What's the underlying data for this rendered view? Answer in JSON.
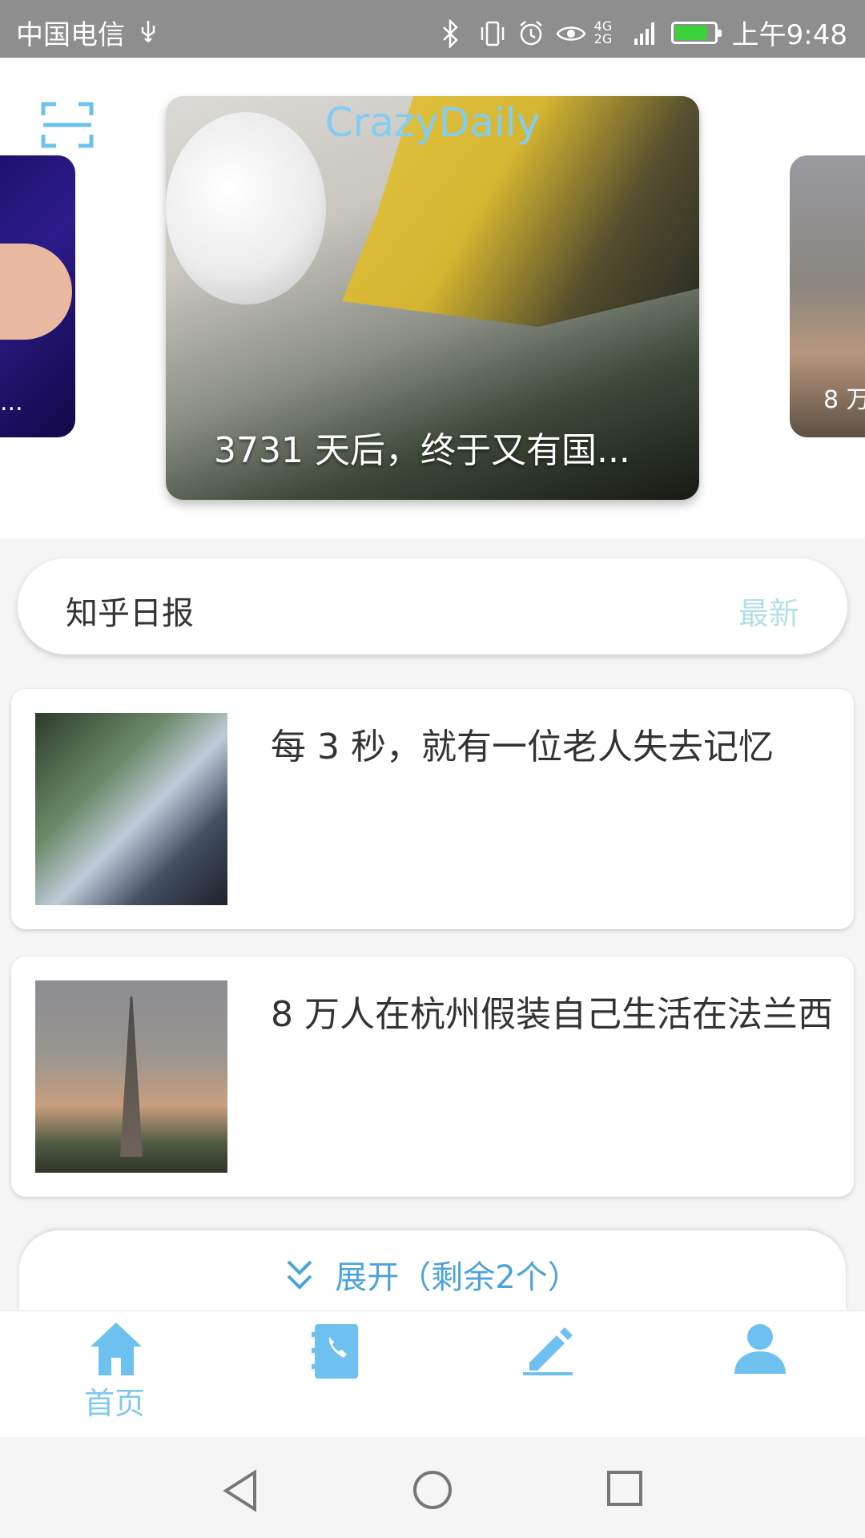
{
  "status_bar": {
    "carrier": "中国电信",
    "time": "上午9:48",
    "signal_text": "4G 2G",
    "icons": [
      "usb-icon",
      "bluetooth-icon",
      "vibrate-icon",
      "alarm-icon",
      "eye-icon",
      "signal-icon",
      "battery-icon"
    ]
  },
  "header": {
    "app_title": "CrazyDaily",
    "scan_icon": "scan-icon"
  },
  "carousel": {
    "main_caption": "3731 天后，终于又有国...",
    "left_caption": "...",
    "right_caption": "8 万"
  },
  "section": {
    "title": "知乎日报",
    "link": "最新"
  },
  "articles": [
    {
      "title": "每 3 秒，就有一位老人失去记忆"
    },
    {
      "title": "8 万人在杭州假装自己生活在法兰西"
    }
  ],
  "expand": {
    "label": "展开（剩余2个）",
    "icon": "double-chevron-down-icon"
  },
  "bottom_nav": {
    "items": [
      {
        "label": "首页",
        "icon": "home-icon",
        "active": true
      },
      {
        "label": "",
        "icon": "contacts-book-icon"
      },
      {
        "label": "",
        "icon": "edit-pencil-icon"
      },
      {
        "label": "",
        "icon": "user-icon"
      }
    ]
  },
  "system_nav": [
    "back-icon",
    "home-circle-icon",
    "recents-icon"
  ],
  "colors": {
    "accent": "#7fc8ef",
    "link": "#4da3d9",
    "status_bar": "#8e8e8e"
  }
}
